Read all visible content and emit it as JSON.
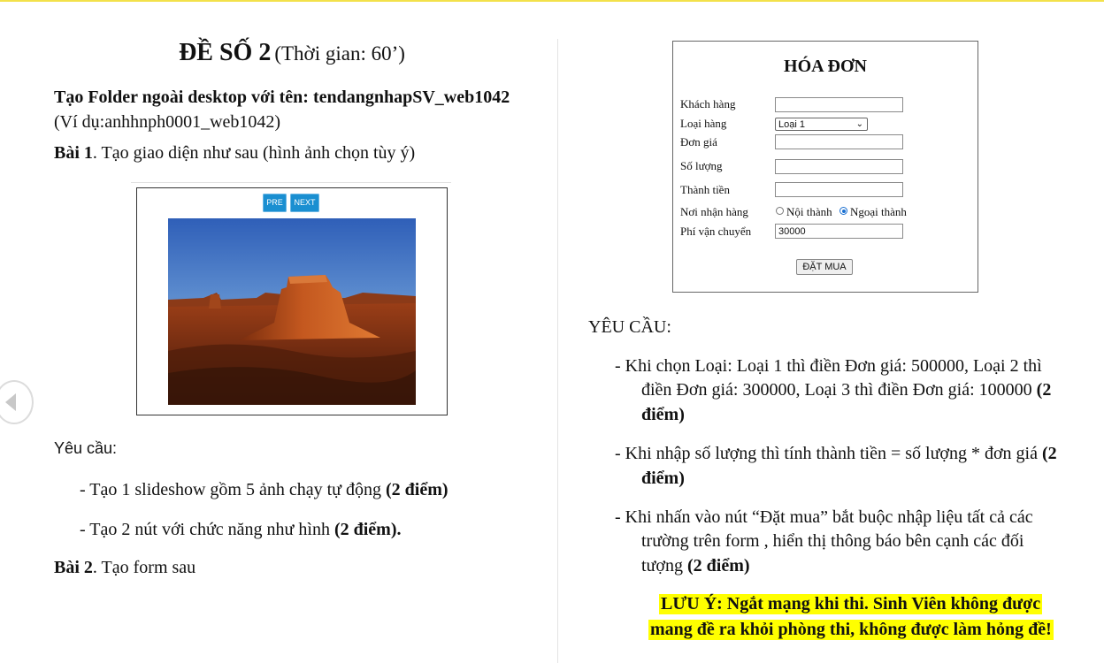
{
  "header": {
    "title_main": "ĐỀ SỐ 2",
    "title_sub": "(Thời gian: 60’)"
  },
  "left": {
    "folder_line": "Tạo Folder ngoài desktop với tên: tendangnhapSV_web1042",
    "example_line": "(Ví dụ:anhhnph0001_web1042)",
    "bai1_label": "Bài 1",
    "bai1_text": ". Tạo giao diện như sau (hình ảnh chọn tùy ý)",
    "requirements_title": "Yêu cầu:",
    "req1_text": "- Tạo 1 slideshow gồm 5 ảnh chạy tự động ",
    "req1_points": "(2 điểm)",
    "req2_text": "- Tạo 2 nút với chức năng như hình ",
    "req2_points": "(2 điểm).",
    "bai2_label": "Bài 2",
    "bai2_text": ". Tạo form sau"
  },
  "slideshow": {
    "prev_label": "PRE",
    "next_label": "NEXT",
    "image_icon": "desert-butte-photo"
  },
  "form": {
    "title": "HÓA ĐƠN",
    "labels": [
      "Khách hàng",
      "Loại hàng",
      "Đơn giá",
      "Số lượng",
      "Thành tiền",
      "Nơi nhận hàng",
      "Phí vận chuyển"
    ],
    "select_value": "Loại 1",
    "radio_inner": "Nội thành",
    "radio_outer": "Ngoại thành",
    "shipping_value": "30000",
    "submit_label": "ĐẶT MUA"
  },
  "right": {
    "requirements_title": "YÊU CẦU:",
    "r1_line1": "- Khi chọn Loại: Loại 1 thì điền Đơn giá: 500000, Loại 2 thì",
    "r1_line2": "điền Đơn giá: 300000, Loại 3 thì điền Đơn giá: 100000 ",
    "r1_points_a": "(2",
    "r1_points_b": "điểm)",
    "r2_line1": "- Khi nhập số lượng thì tính thành tiền = số lượng * đơn giá ",
    "r2_points_a": "(2",
    "r2_points_b": "điểm)",
    "r3_line1": "- Khi nhấn vào nút “Đặt mua” bắt buộc nhập liệu tất cả các",
    "r3_line2": "trường trên form , hiển thị thông báo bên cạnh các đối",
    "r3_line3": "tượng ",
    "r3_points": "(2 điểm)",
    "note_line1": "LƯU Ý: Ngắt mạng khi thi. Sinh Viên không được",
    "note_line2": "mang đề ra khỏi phòng thi, không được làm hỏng đề!"
  },
  "colors": {
    "highlight": "#ffff00",
    "button_blue": "#1a8fd1",
    "top_rule": "#f3e14a"
  }
}
